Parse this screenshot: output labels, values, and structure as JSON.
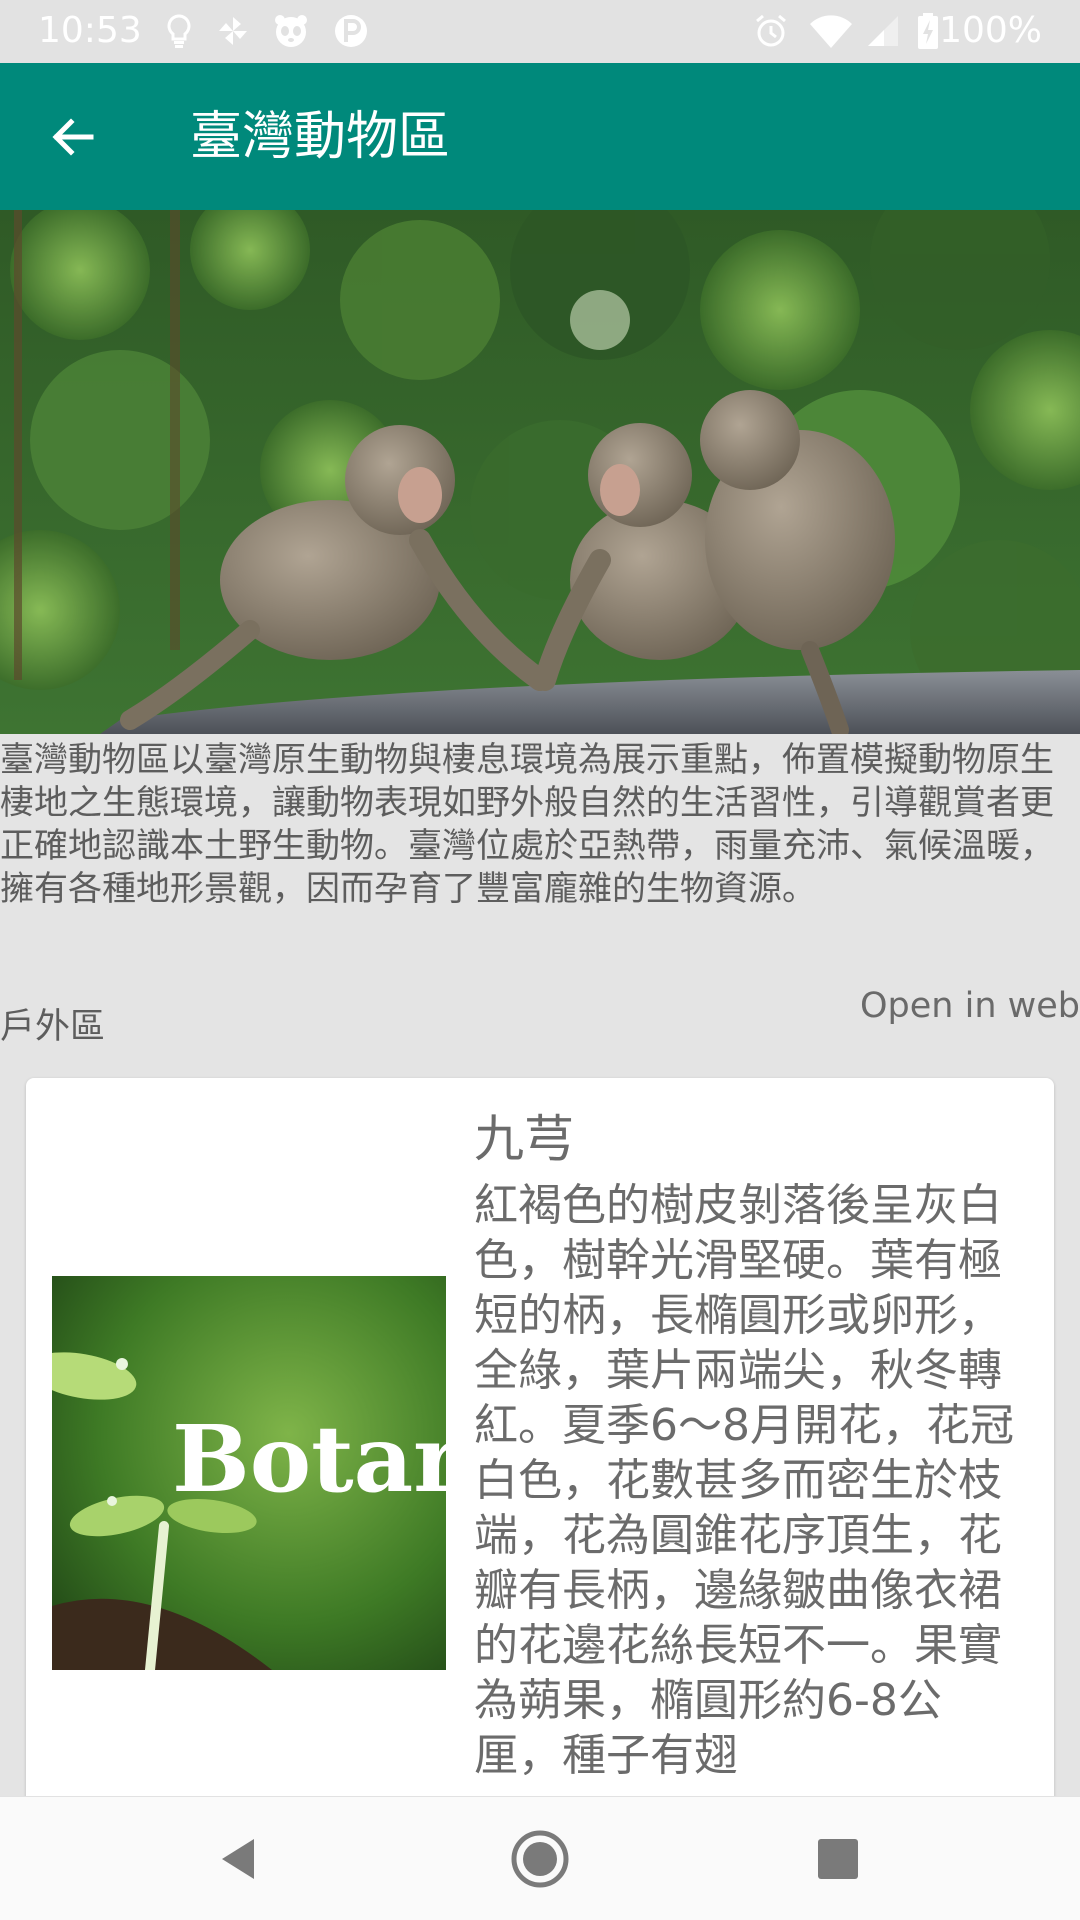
{
  "status_bar": {
    "time": "10:53",
    "battery_text": "100%",
    "left_icons": [
      "lightbulb-icon",
      "pinwheel-icon",
      "panda-icon",
      "p-badge-icon"
    ],
    "right_icons": [
      "alarm-icon",
      "wifi-icon",
      "signal-icon",
      "battery-charging-icon"
    ]
  },
  "app_bar": {
    "title": "臺灣動物區",
    "back_icon": "arrow-left-icon",
    "color": "#00897b"
  },
  "hero": {
    "icon": "macaque-photo"
  },
  "description": "臺灣動物區以臺灣原生動物與棲息環境為展示重點，佈置模擬動物原生棲地之生態環境，讓動物表現如野外般自然的生活習性，引導觀賞者更正確地認識本土野生動物。臺灣位處於亞熱帶，雨量充沛、氣候溫暖，擁有各種地形景觀，因而孕育了豐富龐雜的生物資源。",
  "section": {
    "label": "戶外區",
    "open_web": "Open in web"
  },
  "card": {
    "title": "九芎",
    "thumbnail_text": "Botar",
    "description": "紅褐色的樹皮剝落後呈灰白色，樹幹光滑堅硬。葉有極短的柄，長橢圓形或卵形，全綠，葉片兩端尖，秋冬轉紅。夏季6～8月開花，花冠白色，花數甚多而密生於枝端，花為圓錐花序頂生，花瓣有長柄，邊緣皺曲像衣裙的花邊花絲長短不一。果實為蒴果，橢圓形約6-8公厘，種子有翅"
  },
  "nav_bar": {
    "icons": [
      "back-triangle-icon",
      "home-circle-icon",
      "recents-square-icon"
    ]
  }
}
